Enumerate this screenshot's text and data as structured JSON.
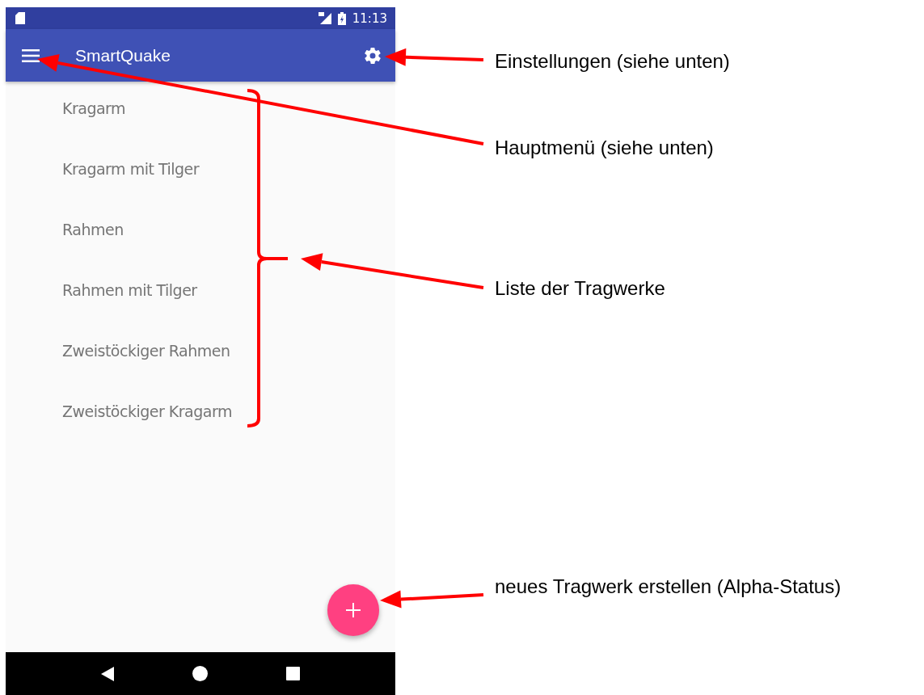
{
  "status_bar": {
    "time": "11:13"
  },
  "app_bar": {
    "title": "SmartQuake"
  },
  "structures": [
    {
      "label": "Kragarm"
    },
    {
      "label": "Kragarm mit Tilger"
    },
    {
      "label": "Rahmen"
    },
    {
      "label": "Rahmen mit Tilger"
    },
    {
      "label": "Zweistöckiger Rahmen"
    },
    {
      "label": "Zweistöckiger Kragarm"
    }
  ],
  "annotations": [
    {
      "text": "Einstellungen (siehe unten)"
    },
    {
      "text": "Hauptmenü (siehe unten)"
    },
    {
      "text": "Liste der Tragwerke"
    },
    {
      "text": "neues Tragwerk erstellen (Alpha-Status)"
    }
  ]
}
